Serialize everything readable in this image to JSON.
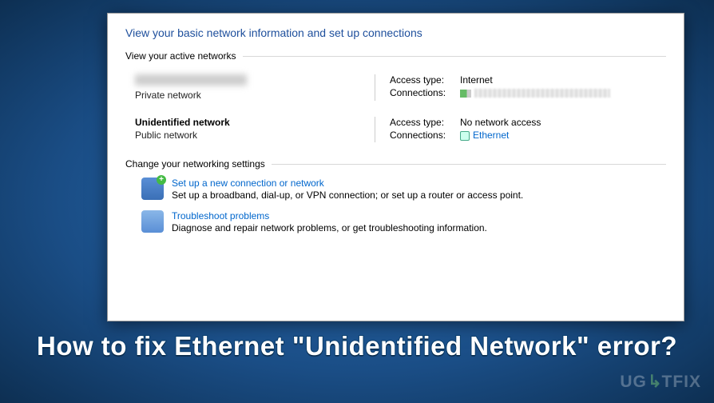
{
  "window": {
    "heading": "View your basic network information and set up connections",
    "active_networks_label": "View your active networks",
    "networks": [
      {
        "name_hidden": true,
        "type": "Private network",
        "access_type_label": "Access type:",
        "access_type_value": "Internet",
        "connections_label": "Connections:",
        "connections_value_hidden": true
      },
      {
        "name": "Unidentified network",
        "type": "Public network",
        "access_type_label": "Access type:",
        "access_type_value": "No network access",
        "connections_label": "Connections:",
        "connections_value": "Ethernet"
      }
    ],
    "change_settings_label": "Change your networking settings",
    "settings": [
      {
        "title": "Set up a new connection or network",
        "desc": "Set up a broadband, dial-up, or VPN connection; or set up a router or access point."
      },
      {
        "title": "Troubleshoot problems",
        "desc": "Diagnose and repair network problems, or get troubleshooting information."
      }
    ]
  },
  "caption": "How to fix Ethernet \"Unidentified Network\" error?",
  "watermark": "UGETFIX"
}
